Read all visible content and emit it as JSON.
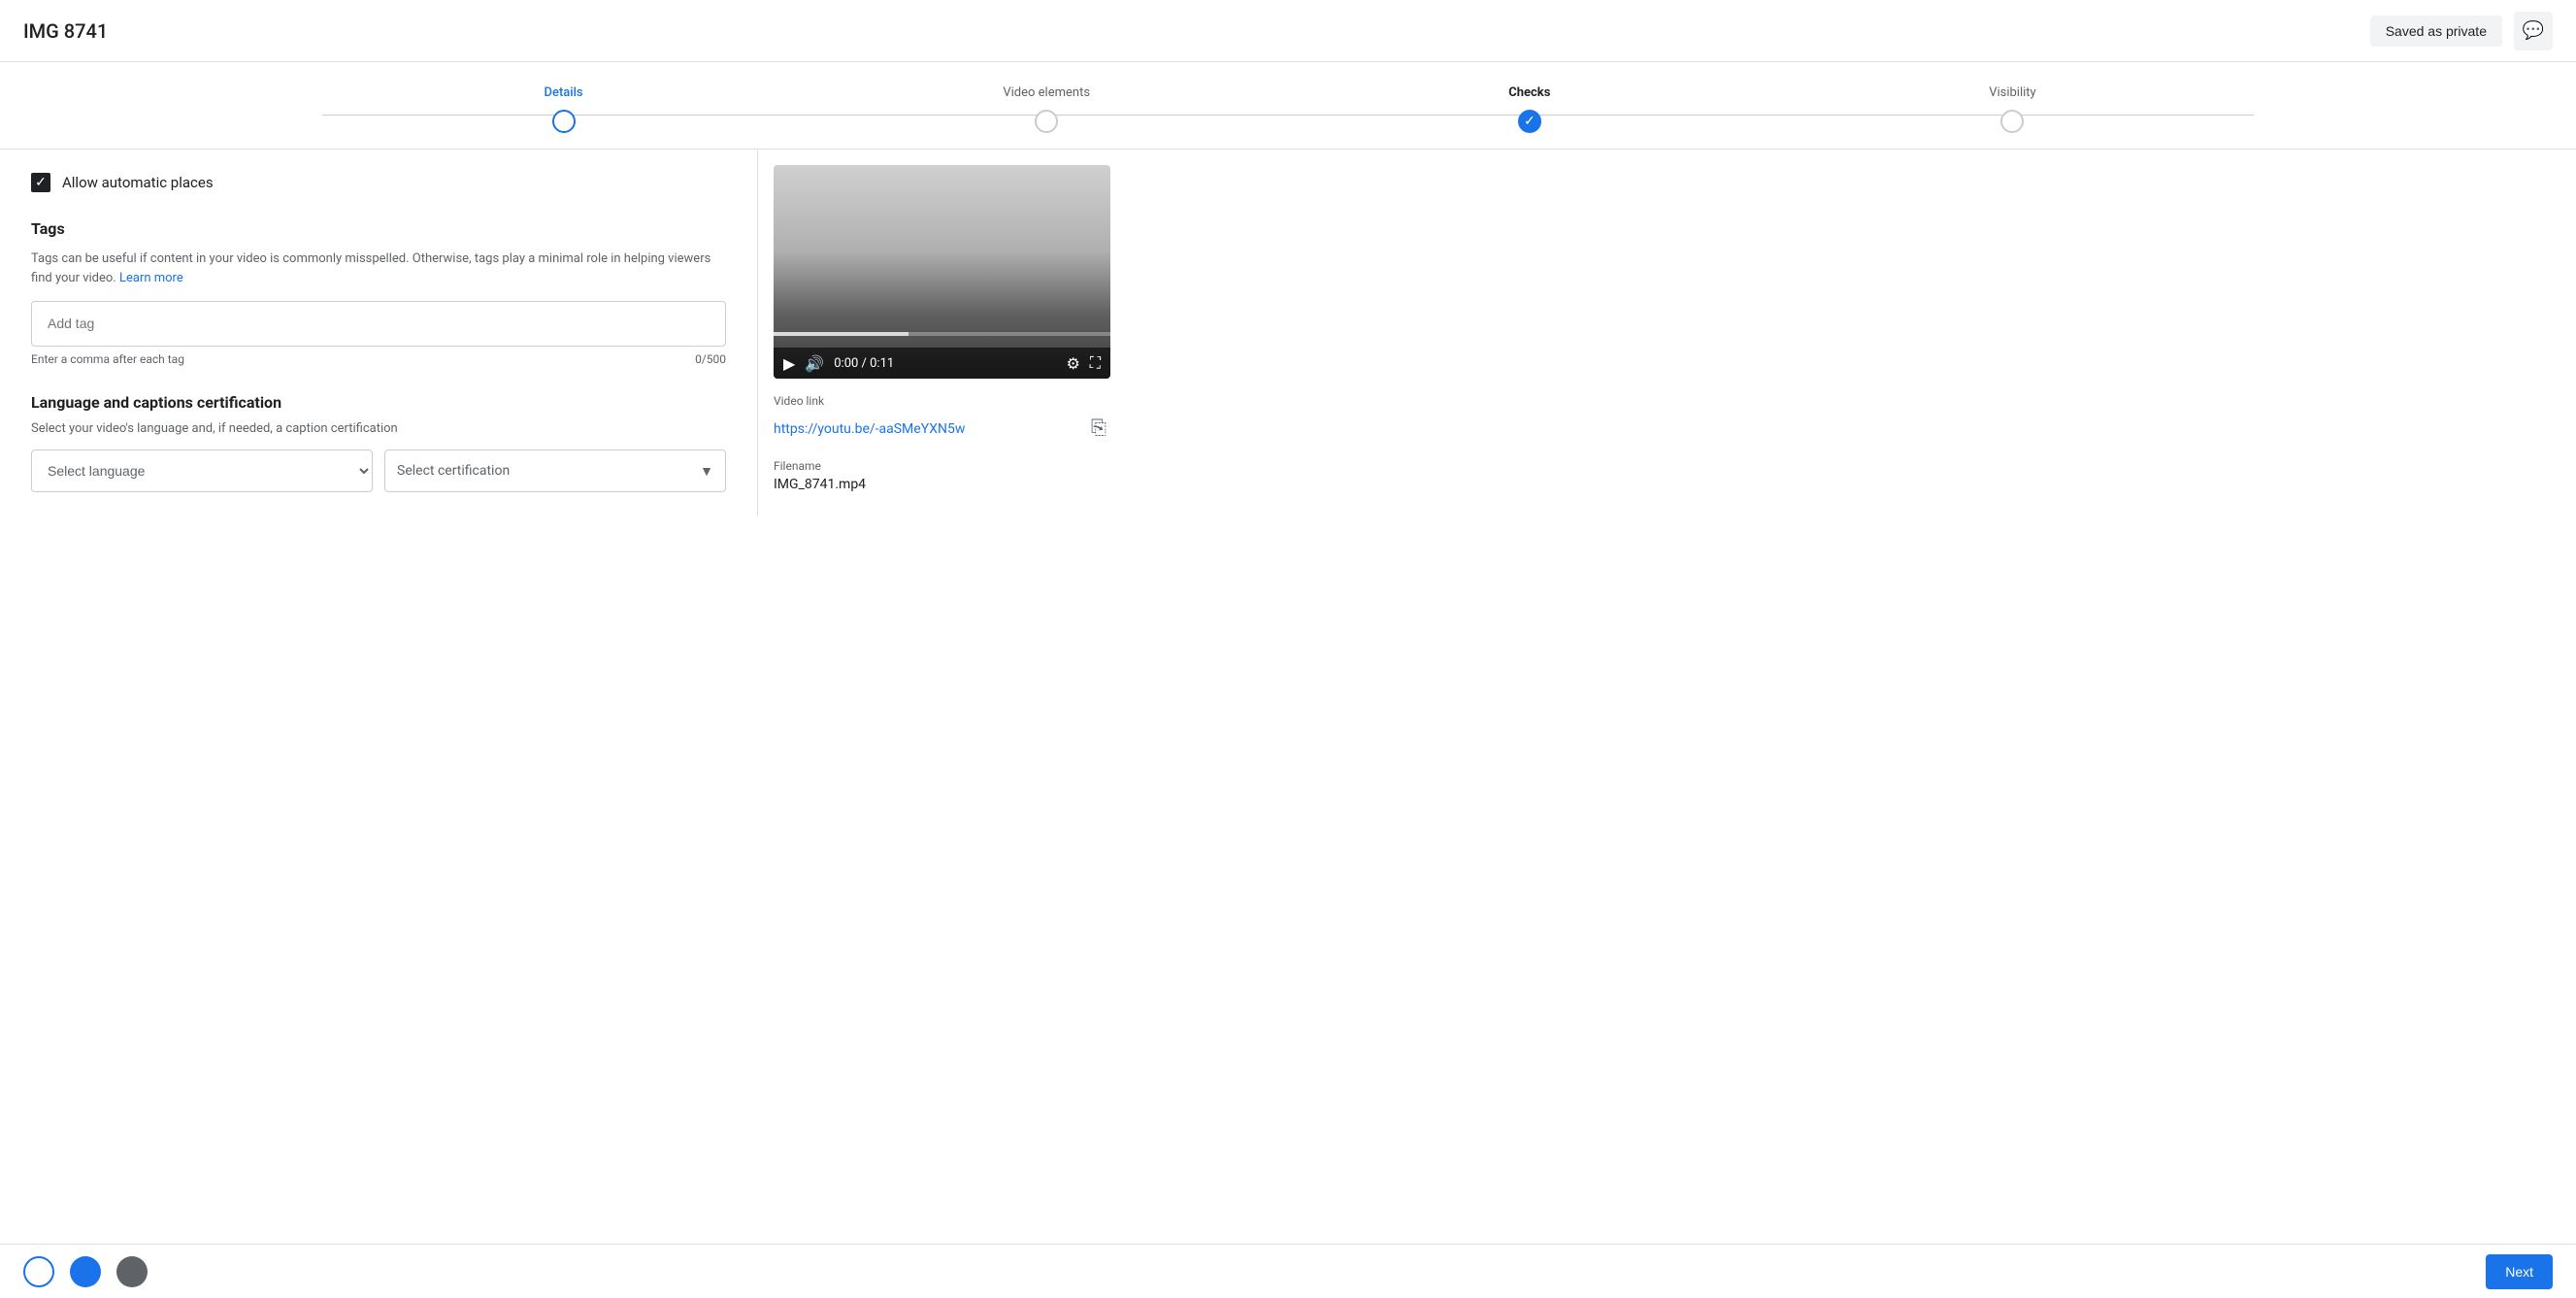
{
  "header": {
    "title": "IMG 8741",
    "saved_label": "Saved as private",
    "chat_icon": "💬"
  },
  "stepper": {
    "steps": [
      {
        "label": "Details",
        "state": "active-outline"
      },
      {
        "label": "Video elements",
        "state": "grey"
      },
      {
        "label": "Checks",
        "state": "filled"
      },
      {
        "label": "Visibility",
        "state": "grey"
      }
    ]
  },
  "allow_automatic_places": {
    "label": "Allow automatic places",
    "checked": true
  },
  "tags": {
    "title": "Tags",
    "description": "Tags can be useful if content in your video is commonly misspelled. Otherwise, tags play a minimal role in helping viewers find your video.",
    "learn_more": "Learn more",
    "placeholder": "Add tag",
    "hint": "Enter a comma after each tag",
    "count": "0/500"
  },
  "language": {
    "title": "Language and captions certification",
    "description": "Select your video's language and, if needed, a caption certification"
  },
  "video": {
    "time_current": "0:00",
    "time_total": "0:11",
    "time_display": "0:00 / 0:11",
    "progress_percent": 0,
    "link_label": "Video link",
    "link_url": "https://youtu.be/-aaSMeYXN5w",
    "filename_label": "Filename",
    "filename_value": "IMG_8741.mp4"
  },
  "nav": {
    "next_label": "Next"
  }
}
